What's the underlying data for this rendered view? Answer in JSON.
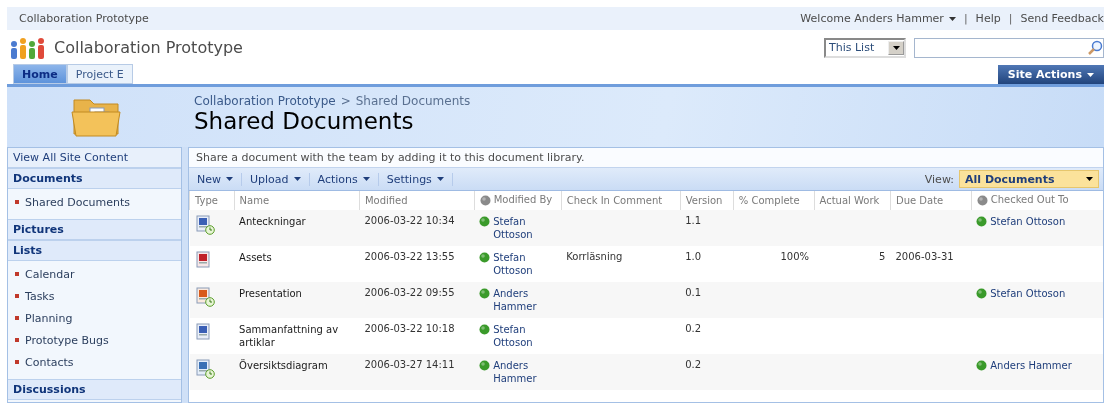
{
  "top_bar": {
    "site": "Collaboration Prototype",
    "welcome": "Welcome Anders Hammer",
    "separator": "|",
    "links": [
      "Help",
      "Send Feedback"
    ]
  },
  "header": {
    "title": "Collaboration Prototype",
    "scope": "This List"
  },
  "tabs": [
    {
      "label": "Home",
      "selected": true
    },
    {
      "label": "Project E",
      "selected": false
    }
  ],
  "site_actions": "Site Actions",
  "breadcrumb": {
    "link": "Collaboration Prototype",
    "separator": ">",
    "current": "Shared Documents"
  },
  "page_title": "Shared Documents",
  "nav": {
    "view_all": "View All Site Content",
    "sections": [
      {
        "heading": "Documents",
        "items": [
          "Shared Documents"
        ]
      },
      {
        "heading": "Pictures"
      },
      {
        "heading": "Lists",
        "items": [
          "Calendar",
          "Tasks",
          "Planning",
          "Prototype Bugs",
          "Contacts"
        ]
      },
      {
        "heading": "Discussions"
      }
    ]
  },
  "description": "Share a document with the team by adding it to this document library.",
  "toolbar": {
    "menus": [
      "New",
      "Upload",
      "Actions",
      "Settings"
    ],
    "view_label": "View:",
    "view_value": "All Documents"
  },
  "table": {
    "columns": [
      "Type",
      "Name",
      "Modified",
      "Modified By",
      "Check In Comment",
      "Version",
      "% Complete",
      "Actual Work",
      "Due Date",
      "Checked Out To"
    ],
    "rows": [
      {
        "kind": "word",
        "checked_out": true,
        "name": "Anteckningar",
        "modified": "2006-03-22 10:34",
        "modified_by": "Stefan Ottoson",
        "version": "1.1",
        "checked_out_to": "Stefan Ottoson"
      },
      {
        "kind": "pdf",
        "checked_out": false,
        "name": "Assets",
        "modified": "2006-03-22 13:55",
        "modified_by": "Stefan Ottoson",
        "comment": "Korrläsning",
        "version": "1.0",
        "complete": "100%",
        "work": "5",
        "due": "2006-03-31"
      },
      {
        "kind": "ppt",
        "checked_out": true,
        "name": "Presentation",
        "modified": "2006-03-22 09:55",
        "modified_by": "Anders Hammer",
        "version": "0.1",
        "checked_out_to": "Stefan Ottoson"
      },
      {
        "kind": "word",
        "checked_out": false,
        "name": "Sammanfattning av artiklar",
        "modified": "2006-03-22 10:18",
        "modified_by": "Stefan Ottoson",
        "version": "0.2"
      },
      {
        "kind": "visio",
        "checked_out": true,
        "name": "Översiktsdiagram",
        "modified": "2006-03-27 14:11",
        "modified_by": "Anders Hammer",
        "version": "0.2",
        "checked_out_to": "Anders Hammer"
      }
    ]
  }
}
